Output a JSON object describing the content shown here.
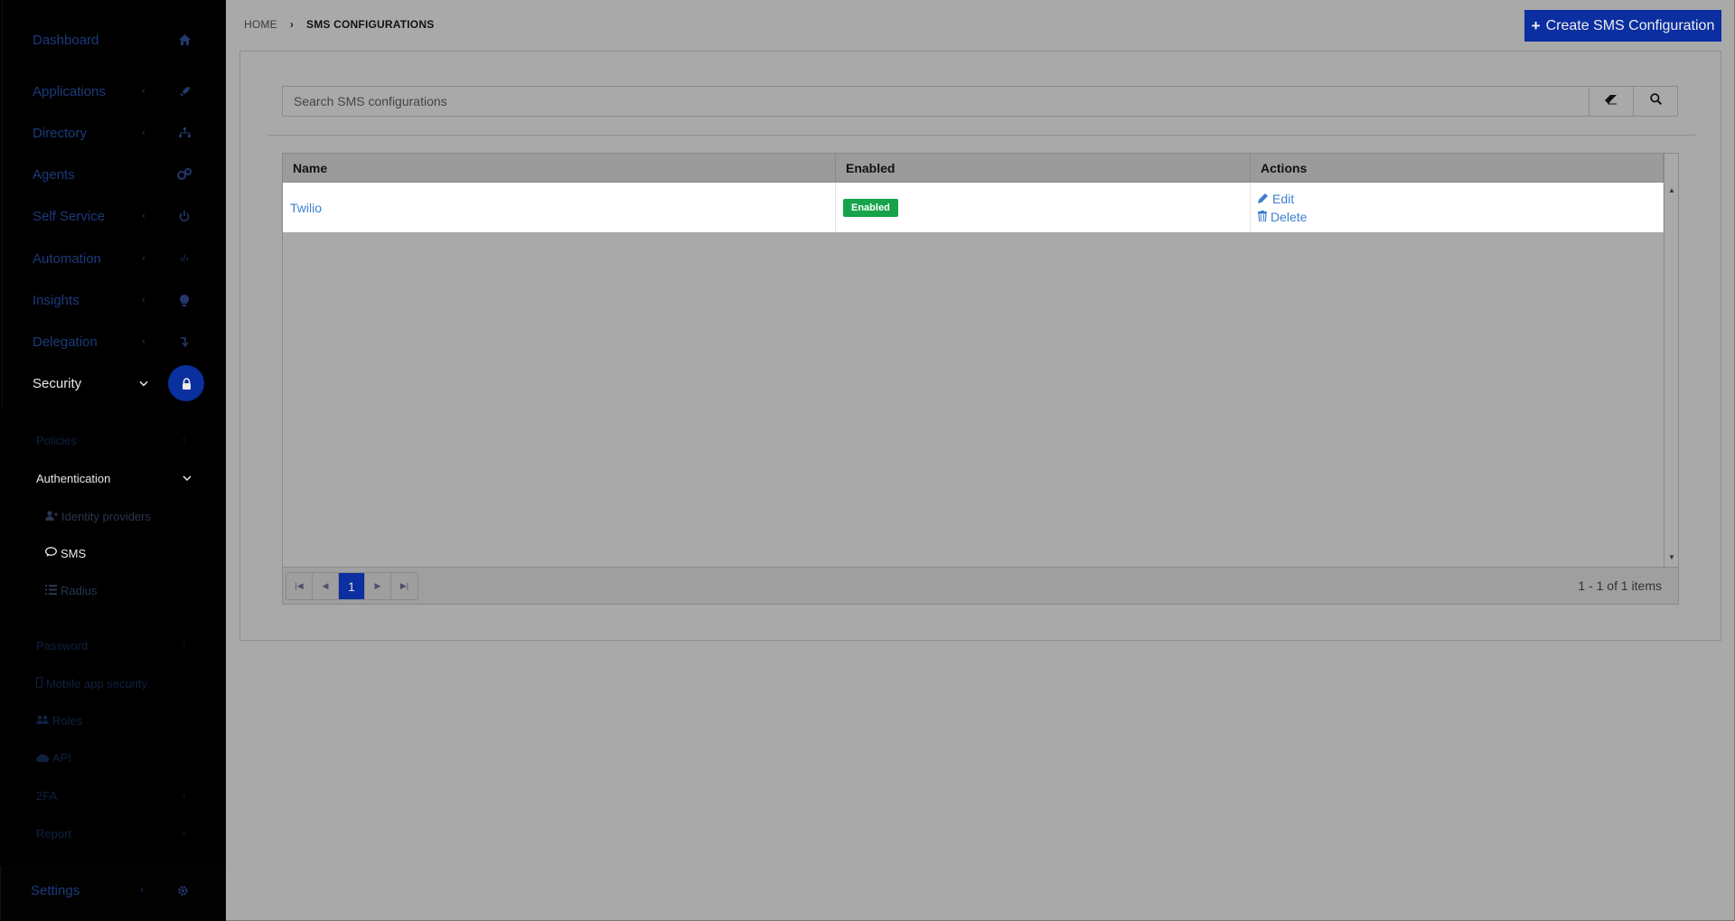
{
  "sidebar": {
    "nav": [
      {
        "label": "Dashboard",
        "has_chevron": false,
        "icon": "home-icon"
      },
      {
        "label": "Applications",
        "has_chevron": true,
        "icon": "rocket-icon"
      },
      {
        "label": "Directory",
        "has_chevron": true,
        "icon": "sitemap-icon"
      },
      {
        "label": "Agents",
        "has_chevron": false,
        "icon": "cogs-icon"
      },
      {
        "label": "Self Service",
        "has_chevron": true,
        "icon": "power-icon"
      },
      {
        "label": "Automation",
        "has_chevron": true,
        "icon": "code-icon"
      },
      {
        "label": "Insights",
        "has_chevron": true,
        "icon": "lightbulb-icon"
      },
      {
        "label": "Delegation",
        "has_chevron": true,
        "icon": "level-down-icon"
      },
      {
        "label": "Security",
        "has_chevron": true,
        "icon": "lock-icon",
        "active": true
      }
    ],
    "security_sub": {
      "policies": "Policies",
      "authentication": "Authentication",
      "identity_providers": "Identity providers",
      "sms": "SMS",
      "radius": "Radius",
      "password": "Password",
      "mobile_app_security": "Mobile app security",
      "roles": "Roles",
      "api": "API",
      "twofa": "2FA",
      "report": "Report"
    },
    "settings": "Settings"
  },
  "breadcrumb": {
    "home": "HOME",
    "current": "SMS CONFIGURATIONS"
  },
  "toolbar": {
    "create_label": "Create SMS Configuration"
  },
  "search": {
    "placeholder": "Search SMS configurations",
    "value": ""
  },
  "table": {
    "columns": [
      "Name",
      "Enabled",
      "Actions"
    ],
    "rows": [
      {
        "name": "Twilio",
        "enabled": "Enabled",
        "edit": "Edit",
        "delete": "Delete"
      }
    ]
  },
  "pager": {
    "current_page": "1",
    "info": "1 - 1 of 1 items"
  },
  "colors": {
    "accent": "#0b2fa0",
    "link": "#3f7fcf",
    "success": "#16a34a"
  }
}
